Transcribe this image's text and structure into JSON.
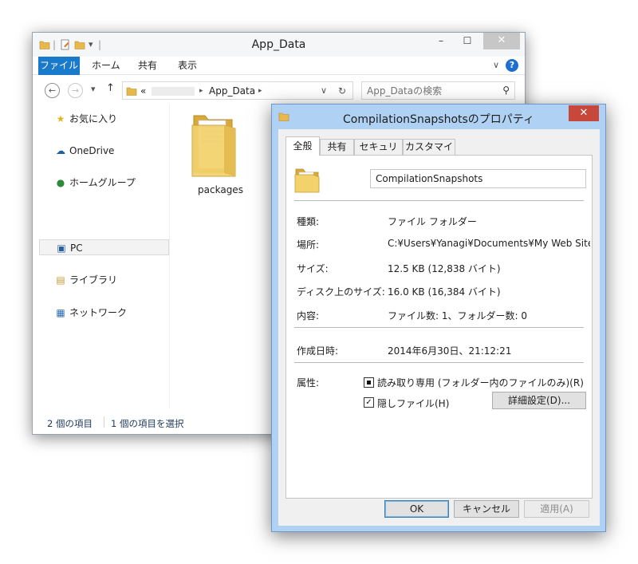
{
  "explorer": {
    "title": "App_Data",
    "qat_separator": "|",
    "qat_dropdown": "▾",
    "minimize": "–",
    "maximize": "☐",
    "close": "✕",
    "ribbon_tabs": {
      "file": "ファイル",
      "home": "ホーム",
      "share": "共有",
      "view": "表示"
    },
    "ribbon_expand": "∨",
    "help": "?",
    "nav": {
      "back": "←",
      "forward": "→",
      "recent": "▾",
      "up": "↑",
      "address_prefix": "«",
      "address_sep": "▸",
      "address_current": "App_Data",
      "address_sep2": "▸",
      "address_dropdown": "∨",
      "refresh": "↻",
      "search_placeholder": "App_Dataの検索",
      "search_glyph": "⚲"
    },
    "sidebar": [
      {
        "name": "favorites",
        "icon": "★",
        "label": "お気に入り"
      },
      {
        "name": "onedrive",
        "icon": "☁",
        "label": "OneDrive"
      },
      {
        "name": "homegroup",
        "icon": "●",
        "label": "ホームグループ"
      },
      {
        "name": "pc",
        "icon": "▣",
        "label": "PC"
      },
      {
        "name": "libraries",
        "icon": "▤",
        "label": "ライブラリ"
      },
      {
        "name": "network",
        "icon": "▦",
        "label": "ネットワーク"
      }
    ],
    "files": [
      {
        "name": "packages"
      }
    ],
    "status": {
      "count": "2 個の項目",
      "selected": "1 個の項目を選択"
    }
  },
  "properties": {
    "title": "CompilationSnapshotsのプロパティ",
    "close": "✕",
    "tabs": [
      "全般",
      "共有",
      "セキュリティ",
      "カスタマイズ"
    ],
    "folder_name": "CompilationSnapshots",
    "fields": [
      {
        "label": "種類:",
        "value": "ファイル フォルダー"
      },
      {
        "label": "場所:",
        "value": "C:¥Users¥Yanagi¥Documents¥My Web Sites¥"
      },
      {
        "label": "サイズ:",
        "value": "12.5 KB (12,838 バイト)"
      },
      {
        "label": "ディスク上のサイズ:",
        "value": "16.0 KB (16,384 バイト)"
      },
      {
        "label": "内容:",
        "value": "ファイル数: 1、フォルダー数: 0"
      }
    ],
    "created_label": "作成日時:",
    "created_value": "2014年6月30日、21:12:21",
    "attributes_label": "属性:",
    "readonly_label": "読み取り専用 (フォルダー内のファイルのみ)(R)",
    "readonly_state": "indeterminate",
    "hidden_label": "隠しファイル(H)",
    "hidden_mark": "✓",
    "advanced_button": "詳細設定(D)...",
    "ok_button": "OK",
    "cancel_button": "キャンセル",
    "apply_button": "適用(A)"
  },
  "colors": {
    "ribbon_file_tab": "#1979ca",
    "dialog_frame": "#afd1f3",
    "close_button": "#c7483a",
    "folder_yellow": "#f3d26b"
  }
}
